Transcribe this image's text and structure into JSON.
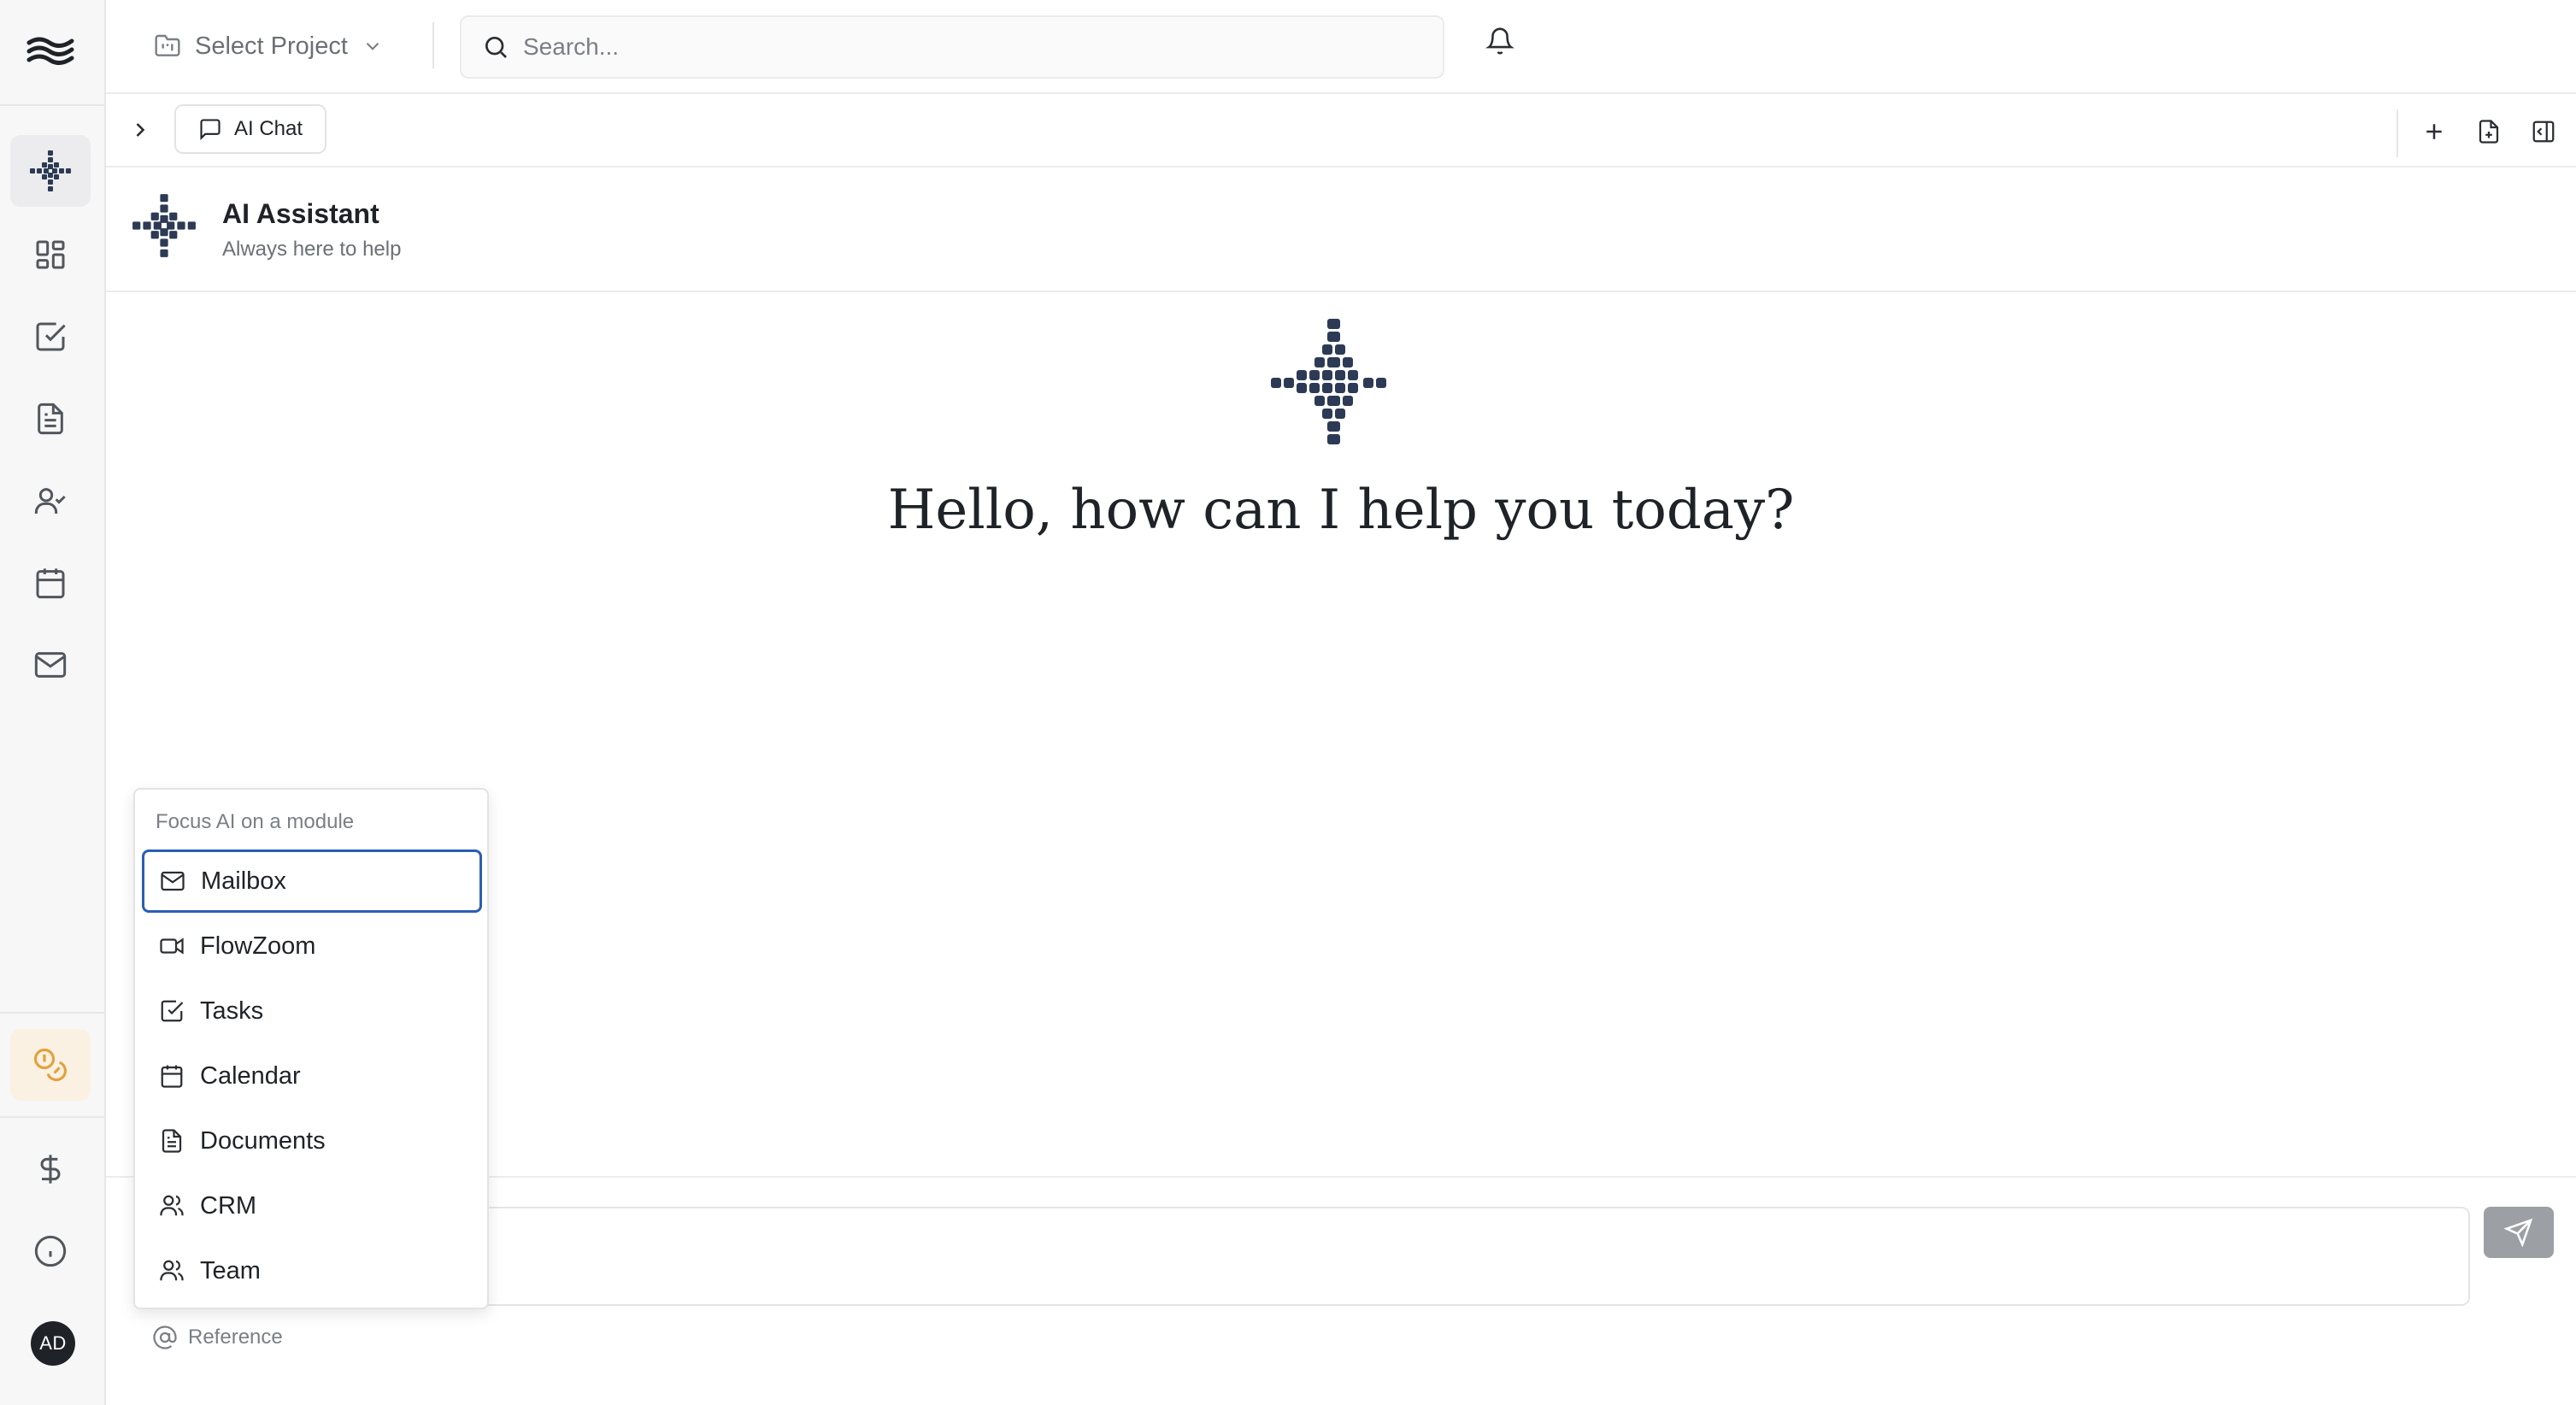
{
  "topbar": {
    "project_select": "Select Project",
    "search_placeholder": "Search..."
  },
  "tabs": [
    {
      "label": "AI Chat",
      "icon": "message-square-icon"
    }
  ],
  "assistant": {
    "name": "AI Assistant",
    "tagline": "Always here to help"
  },
  "welcome": {
    "heading": "Hello, how can I help you today?"
  },
  "module_menu": {
    "title": "Focus AI on a module",
    "selected": "Mailbox",
    "items": [
      {
        "label": "Mailbox",
        "icon": "mail-icon"
      },
      {
        "label": "FlowZoom",
        "icon": "video-icon"
      },
      {
        "label": "Tasks",
        "icon": "check-square-icon"
      },
      {
        "label": "Calendar",
        "icon": "calendar-icon"
      },
      {
        "label": "Documents",
        "icon": "file-text-icon"
      },
      {
        "label": "CRM",
        "icon": "users-icon"
      },
      {
        "label": "Team",
        "icon": "users-icon"
      }
    ]
  },
  "composer": {
    "reference_label": "Reference"
  },
  "user": {
    "initials": "AD"
  },
  "colors": {
    "accent_orange": "#e3a13c",
    "selected_border": "#2b5eb5",
    "logo_navy": "#2c3a55"
  }
}
